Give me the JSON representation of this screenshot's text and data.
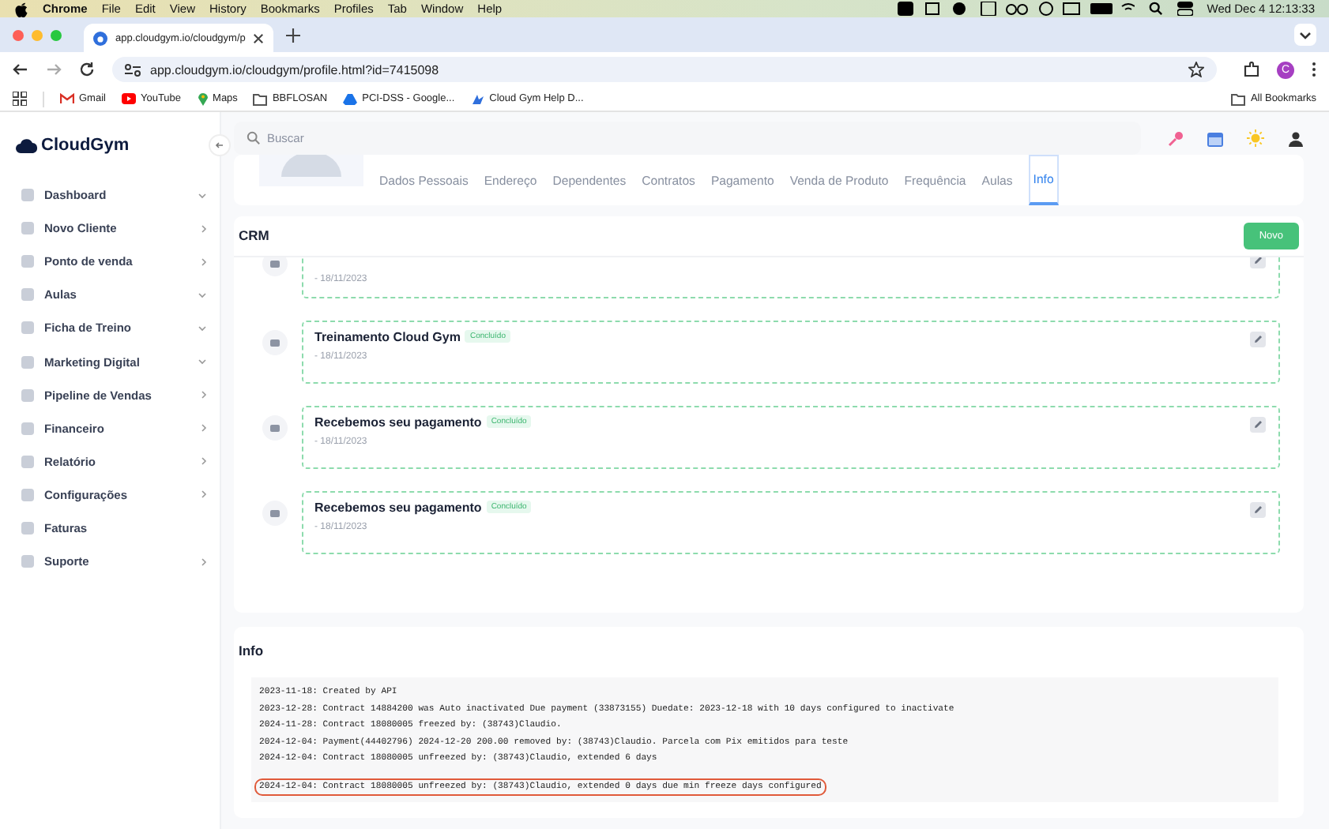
{
  "menubar": {
    "app": "Chrome",
    "menus": [
      "File",
      "Edit",
      "View",
      "History",
      "Bookmarks",
      "Profiles",
      "Tab",
      "Window",
      "Help"
    ],
    "clock": "Wed Dec 4  12:13:33"
  },
  "browser": {
    "tab_title": "app.cloudgym.io/cloudgym/p",
    "url": "app.cloudgym.io/cloudgym/profile.html?id=7415098",
    "profile_initial": "C",
    "bookmarks": [
      "Gmail",
      "YouTube",
      "Maps",
      "BBFLOSAN",
      "PCI-DSS - Google...",
      "Cloud Gym Help D..."
    ],
    "all_bookmarks": "All Bookmarks"
  },
  "logo": "CloudGym",
  "sidebar": {
    "items": [
      {
        "label": "Dashboard",
        "kind": "dropdown"
      },
      {
        "label": "Novo Cliente",
        "kind": "submenu"
      },
      {
        "label": "Ponto de venda",
        "kind": "submenu"
      },
      {
        "label": "Aulas",
        "kind": "dropdown"
      },
      {
        "label": "Ficha de Treino",
        "kind": "dropdown"
      },
      {
        "label": "Marketing Digital",
        "kind": "dropdown"
      },
      {
        "label": "Pipeline de Vendas",
        "kind": "submenu"
      },
      {
        "label": "Financeiro",
        "kind": "submenu"
      },
      {
        "label": "Relatório",
        "kind": "submenu"
      },
      {
        "label": "Configurações",
        "kind": "submenu"
      },
      {
        "label": "Faturas",
        "kind": "link"
      },
      {
        "label": "Suporte",
        "kind": "submenu"
      }
    ]
  },
  "search": {
    "placeholder": "Buscar"
  },
  "profile_tabs": [
    {
      "label": "Dados Pessoais",
      "selected": false
    },
    {
      "label": "Endereço",
      "selected": false
    },
    {
      "label": "Dependentes",
      "selected": false
    },
    {
      "label": "Contratos",
      "selected": false
    },
    {
      "label": "Pagamento",
      "selected": false
    },
    {
      "label": "Venda de Produto",
      "selected": false
    },
    {
      "label": "Frequência",
      "selected": false
    },
    {
      "label": "Aulas",
      "selected": false
    },
    {
      "label": "Info",
      "selected": true
    }
  ],
  "crm": {
    "title": "CRM",
    "new_button": "Novo",
    "items": [
      {
        "date": "- 18/11/2023"
      },
      {
        "title": "Treinamento Cloud Gym",
        "status": "Concluído",
        "date": "- 18/11/2023"
      },
      {
        "title": "Recebemos seu pagamento",
        "status": "Concluído",
        "date": "- 18/11/2023"
      },
      {
        "title": "Recebemos seu pagamento",
        "status": "Concluído",
        "date": "- 18/11/2023"
      }
    ]
  },
  "info": {
    "title": "Info",
    "log": [
      {
        "text": "2023-11-18: Created by API",
        "highlighted": false
      },
      {
        "text": "2023-12-28: Contract 14884200 was Auto inactivated Due payment (33873155) Duedate: 2023-12-18 with 10 days configured to inactivate",
        "highlighted": false
      },
      {
        "text": "2024-11-28: Contract 18080005 freezed by: (38743)Claudio.",
        "highlighted": false
      },
      {
        "text": "2024-12-04: Payment(44402796) 2024-12-20 200.00 removed by: (38743)Claudio. Parcela com Pix emitidos para teste",
        "highlighted": false
      },
      {
        "text": "2024-12-04: Contract 18080005 unfreezed by: (38743)Claudio, extended 6 days",
        "highlighted": false
      },
      {
        "text": "2024-12-04: Contract 18080005 unfreezed by: (38743)Claudio, extended 0 days due min freeze days configured",
        "highlighted": true
      }
    ]
  }
}
